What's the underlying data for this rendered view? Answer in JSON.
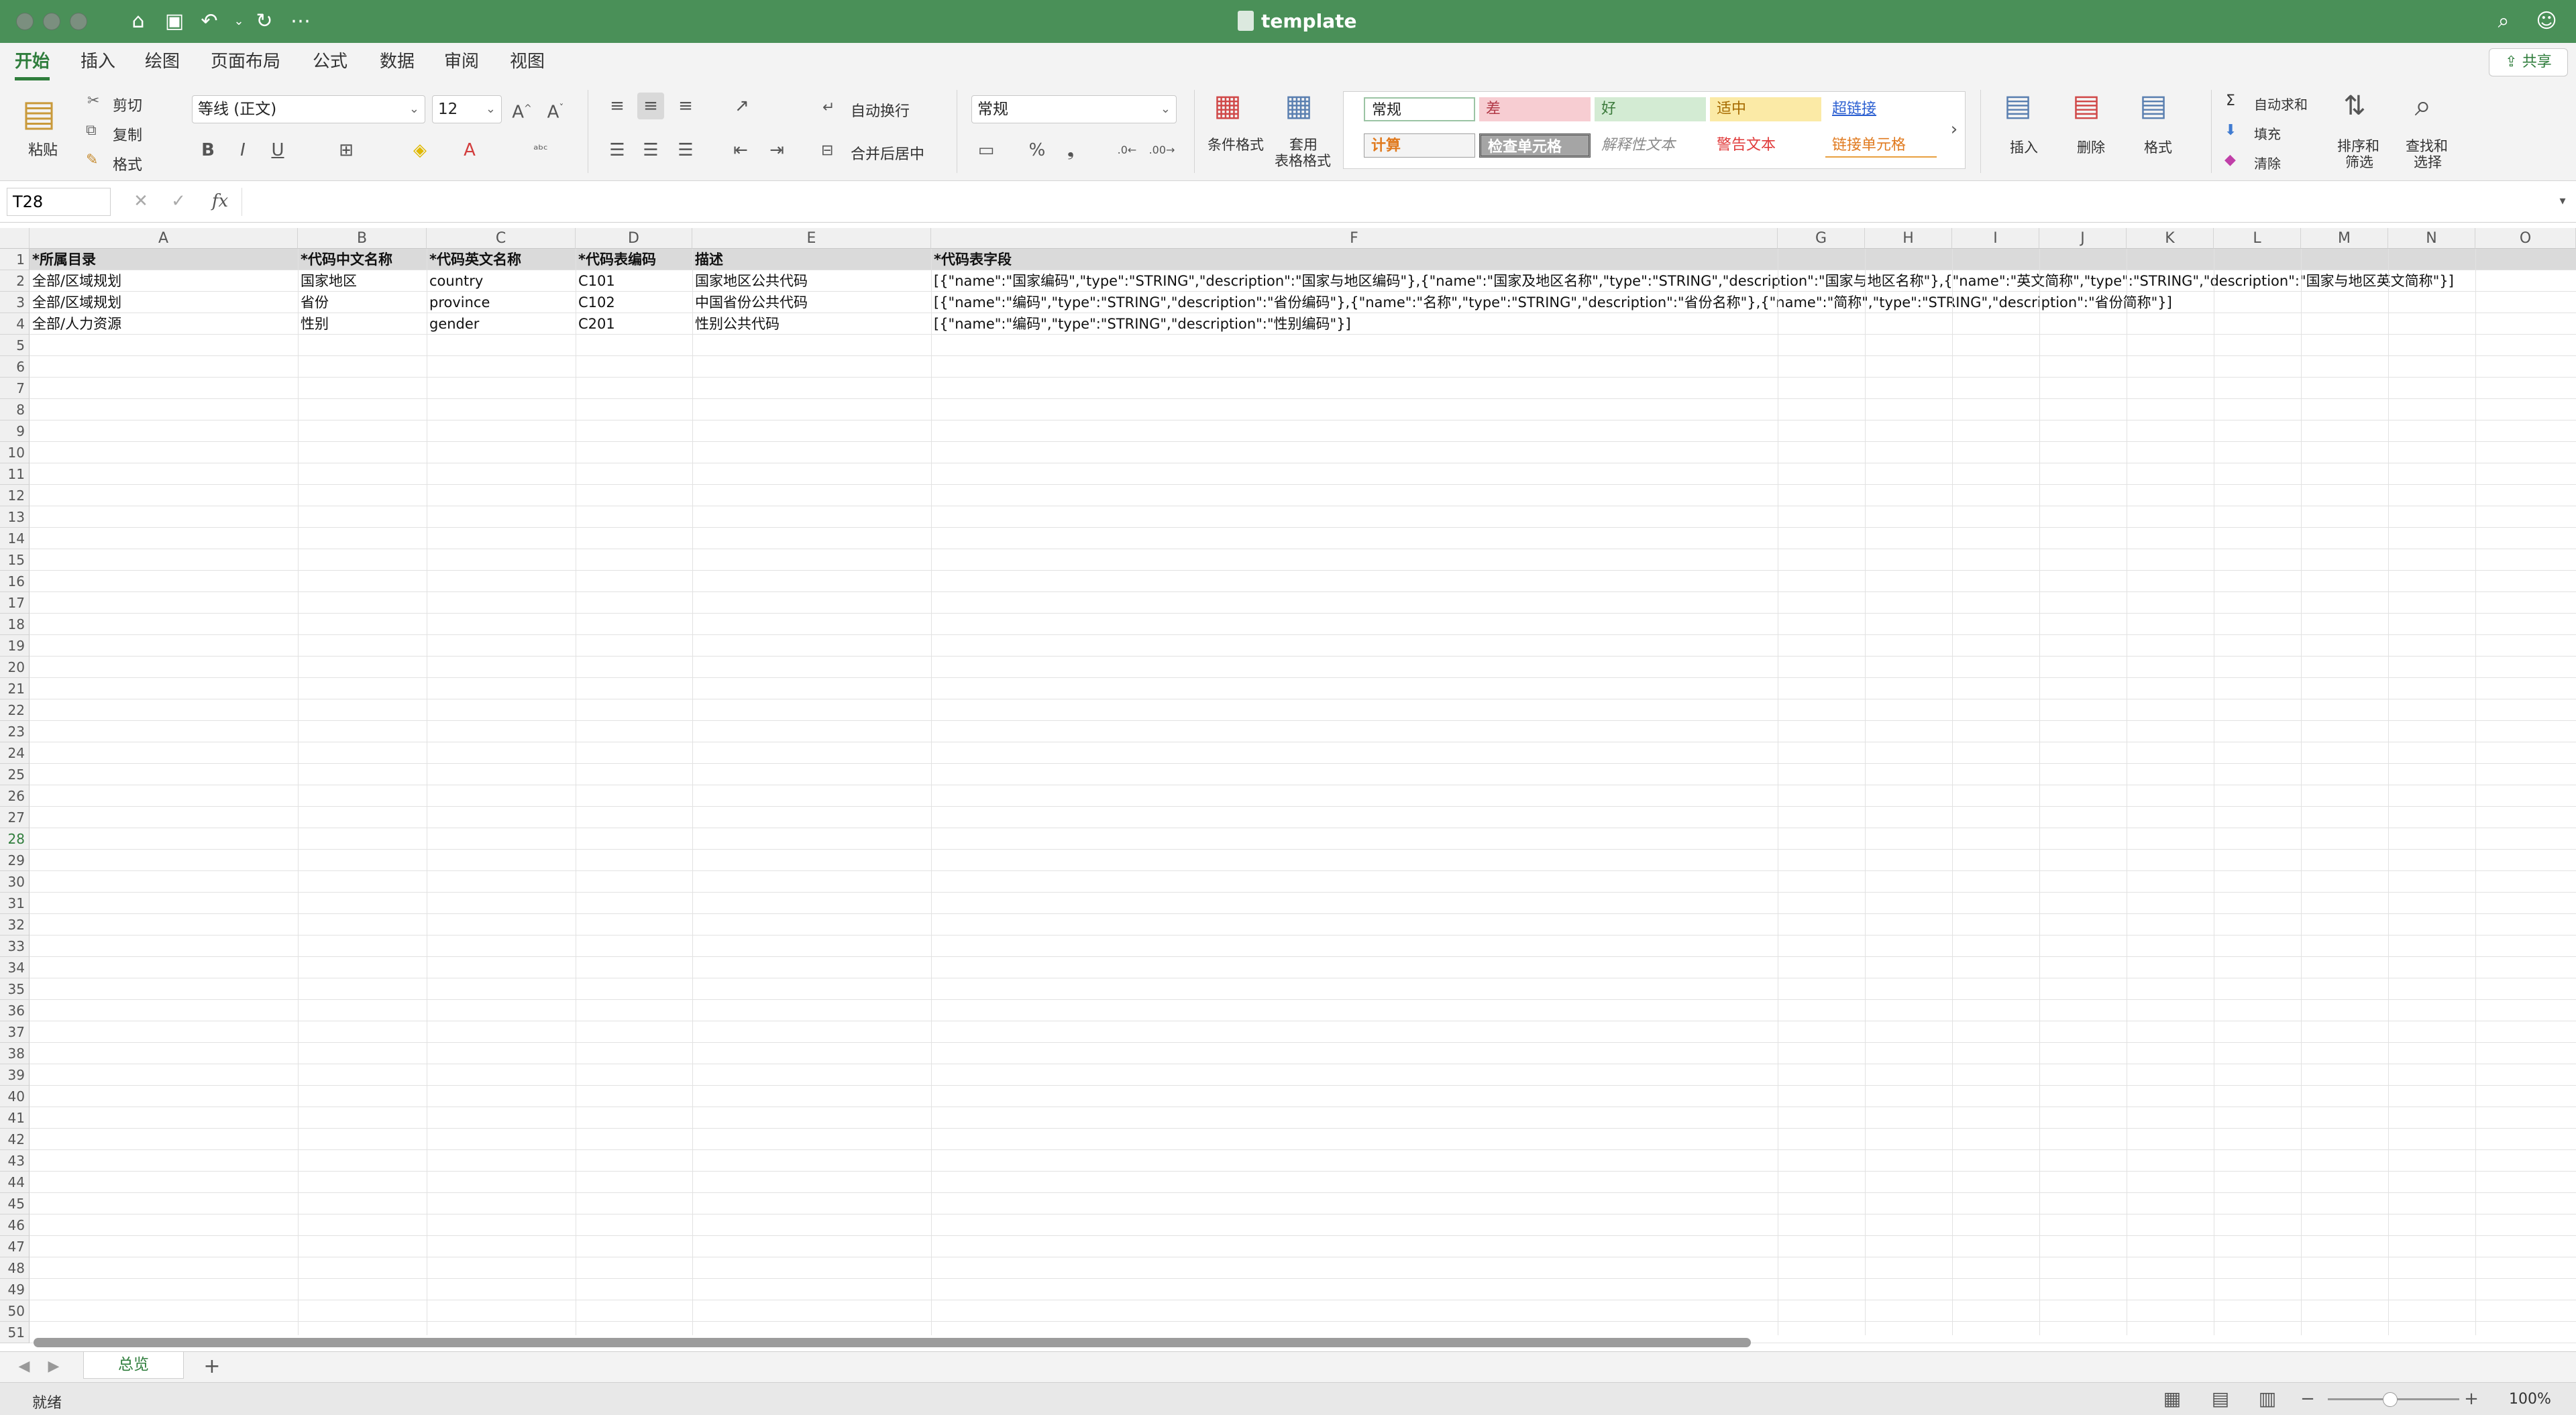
{
  "window": {
    "title": "template"
  },
  "tabs": [
    "开始",
    "插入",
    "绘图",
    "页面布局",
    "公式",
    "数据",
    "审阅",
    "视图"
  ],
  "share_label": "共享",
  "ribbon": {
    "paste": "粘贴",
    "cut": "剪切",
    "copy": "复制",
    "format_painter": "格式",
    "font_name": "等线 (正文)",
    "font_size": "12",
    "bold": "B",
    "italic": "I",
    "underline": "U",
    "wrap_text": "自动换行",
    "merge_center": "合并后居中",
    "number_format": "常规",
    "conditional_format": "条件格式",
    "table_format_1": "套用",
    "table_format_2": "表格格式",
    "styles": {
      "normal": "常规",
      "bad": "差",
      "good": "好",
      "neutral": "适中",
      "hyperlink": "超链接",
      "calculation": "计算",
      "check_cell": "检查单元格",
      "explanatory": "解释性文本",
      "warning": "警告文本",
      "linked_cell": "链接单元格"
    },
    "insert": "插入",
    "delete": "删除",
    "format": "格式",
    "autosum": "自动求和",
    "fill": "填充",
    "clear": "清除",
    "sort_filter_1": "排序和",
    "sort_filter_2": "筛选",
    "find_select_1": "查找和",
    "find_select_2": "选择"
  },
  "formula_bar": {
    "name_box": "T28",
    "fx": "fx",
    "content": ""
  },
  "columns": [
    "A",
    "B",
    "C",
    "D",
    "E",
    "F",
    "G",
    "H",
    "I",
    "J",
    "K",
    "L",
    "M",
    "N",
    "O"
  ],
  "rows": [
    [
      "*所属目录",
      "*代码中文名称",
      "*代码英文名称",
      "*代码表编码",
      "描述",
      "*代码表字段"
    ],
    [
      "全部/区域规划",
      "国家地区",
      "country",
      "C101",
      "国家地区公共代码",
      "[{\"name\":\"国家编码\",\"type\":\"STRING\",\"description\":\"国家与地区编码\"},{\"name\":\"国家及地区名称\",\"type\":\"STRING\",\"description\":\"国家与地区名称\"},{\"name\":\"英文简称\",\"type\":\"STRING\",\"description\":\"国家与地区英文简称\"}]"
    ],
    [
      "全部/区域规划",
      "省份",
      "province",
      "C102",
      "中国省份公共代码",
      "[{\"name\":\"编码\",\"type\":\"STRING\",\"description\":\"省份编码\"},{\"name\":\"名称\",\"type\":\"STRING\",\"description\":\"省份名称\"},{\"name\":\"简称\",\"type\":\"STRING\",\"description\":\"省份简称\"}]"
    ],
    [
      "全部/人力资源",
      "性别",
      "gender",
      "C201",
      "性别公共代码",
      "[{\"name\":\"编码\",\"type\":\"STRING\",\"description\":\"性别编码\"}]"
    ]
  ],
  "row_count": 51,
  "selected_row": 28,
  "sheet_tab": "总览",
  "status": {
    "ready": "就绪",
    "zoom": "100%"
  },
  "colors": {
    "accent": "#2f7d3c",
    "titlebar": "#4a9058"
  }
}
